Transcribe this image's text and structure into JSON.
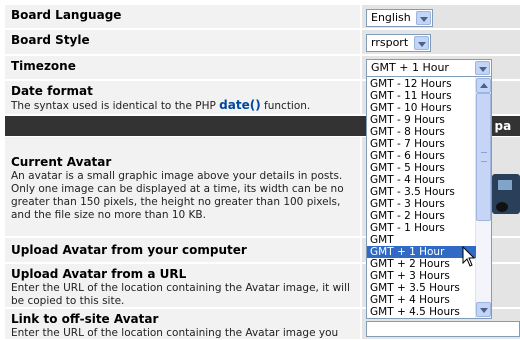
{
  "rows": {
    "board_language": {
      "label": "Board Language",
      "value": "English"
    },
    "board_style": {
      "label": "Board Style",
      "value": "rrsport"
    },
    "timezone": {
      "label": "Timezone",
      "value": "GMT + 1 Hour"
    },
    "date_format": {
      "label": "Date format",
      "desc_before": "The syntax used is identical to the PHP ",
      "link": "date()",
      "desc_after": " function."
    },
    "current_avatar": {
      "label": "Current Avatar",
      "desc": "An avatar is a small graphic image above your details in posts. Only one image can be displayed at a time, its width can be no greater than 150 pixels, the height no greater than 100 pixels, and the file size no more than 10 KB."
    },
    "upload_avatar_computer": {
      "label": "Upload Avatar from your computer"
    },
    "upload_avatar_url": {
      "label": "Upload Avatar from a URL",
      "desc": "Enter the URL of the location containing the Avatar image, it will be copied to this site."
    },
    "link_offsite": {
      "label": "Link to off-site Avatar",
      "desc": "Enter the URL of the location containing the Avatar image you wish to link to."
    }
  },
  "avatar_banner": "ol pa",
  "timezone_options": [
    "GMT - 12 Hours",
    "GMT - 11 Hours",
    "GMT - 10 Hours",
    "GMT - 9 Hours",
    "GMT - 8 Hours",
    "GMT - 7 Hours",
    "GMT - 6 Hours",
    "GMT - 5 Hours",
    "GMT - 4 Hours",
    "GMT - 3.5 Hours",
    "GMT - 3 Hours",
    "GMT - 2 Hours",
    "GMT - 1 Hours",
    "GMT",
    "GMT + 1 Hour",
    "GMT + 2 Hours",
    "GMT + 3 Hours",
    "GMT + 3.5 Hours",
    "GMT + 4 Hours",
    "GMT + 4.5 Hours"
  ],
  "selected_option": "GMT + 1 Hour",
  "colors": {
    "selection": "#316ac5",
    "link": "#0047a0",
    "dark_bar": "#333333"
  }
}
